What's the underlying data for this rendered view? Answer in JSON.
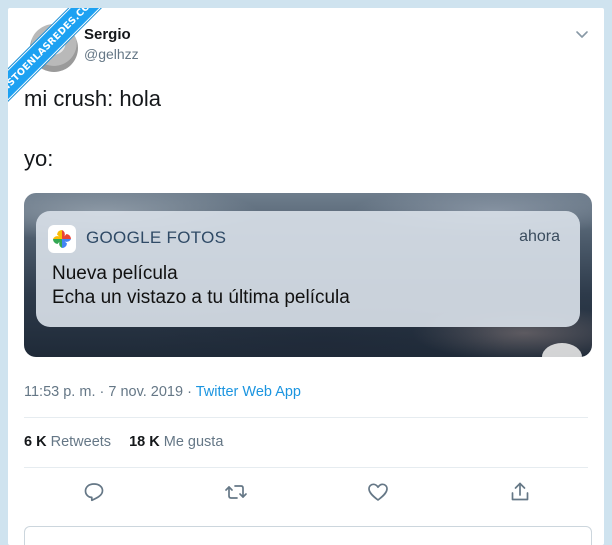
{
  "watermark": {
    "text": "VISTOENLASREDES.COM"
  },
  "author": {
    "name": "Sergio",
    "handle": "@gelhzz"
  },
  "tweet": {
    "line1": "mi crush: hola",
    "line2": "yo:"
  },
  "notification": {
    "app_name": "GOOGLE FOTOS",
    "time": "ahora",
    "title": "Nueva película",
    "body": "Echa un vistazo a tu última película"
  },
  "meta": {
    "timestamp": "11:53 p. m. · 7 nov. 2019 · ",
    "source": "Twitter Web App"
  },
  "stats": {
    "retweets_count": "6 K",
    "retweets_label": "Retweets",
    "likes_count": "18 K",
    "likes_label": "Me gusta"
  },
  "icons": {
    "reply": "reply-icon",
    "retweet": "retweet-icon",
    "like": "heart-icon",
    "share": "share-icon",
    "chevron": "chevron-down-icon",
    "app": "google-photos-icon"
  },
  "colors": {
    "accent": "#1da1f2",
    "link": "#1b95e0",
    "muted": "#657786",
    "text": "#14171a"
  }
}
